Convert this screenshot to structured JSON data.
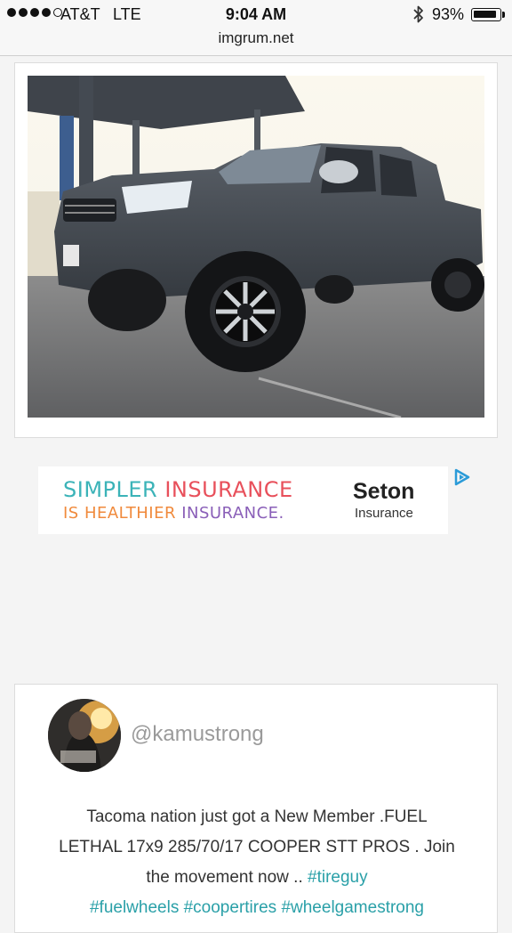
{
  "status_bar": {
    "carrier": "AT&T",
    "network": "LTE",
    "time": "9:04 AM",
    "battery_percent": "93%",
    "battery_level": 0.93,
    "signal_bars_filled": 4,
    "signal_bars_total": 5
  },
  "url_bar": {
    "domain": "imgrum.net"
  },
  "photo": {
    "subject": "Lifted gray Toyota Tacoma pickup truck"
  },
  "ad": {
    "line1_a": "SIMPLER",
    "line1_b": "INSURANCE",
    "line2_a": "IS HEALTHIER",
    "line2_b": "INSURANCE.",
    "brand": "Seton",
    "brand_sub": "Insurance",
    "adchoices_icon": "adchoices-icon"
  },
  "post": {
    "username": "@kamustrong",
    "caption_line1": "Tacoma nation just got a New Member .FUEL",
    "caption_line2": "LETHAL 17x9 285/70/17 COOPER STT PROS . Join",
    "caption_line3_text": "the movement now .. ",
    "hashtags": [
      "#tireguy",
      "#fuelwheels",
      "#coopertires",
      "#wheelgamestrong"
    ]
  },
  "colors": {
    "hashtag": "#2aa0a8",
    "ad_teal": "#3bb3b8",
    "ad_orange": "#f08a3c",
    "ad_red": "#e8505b",
    "ad_purple": "#8a5fb8",
    "ad_green": "#7cc46a"
  }
}
